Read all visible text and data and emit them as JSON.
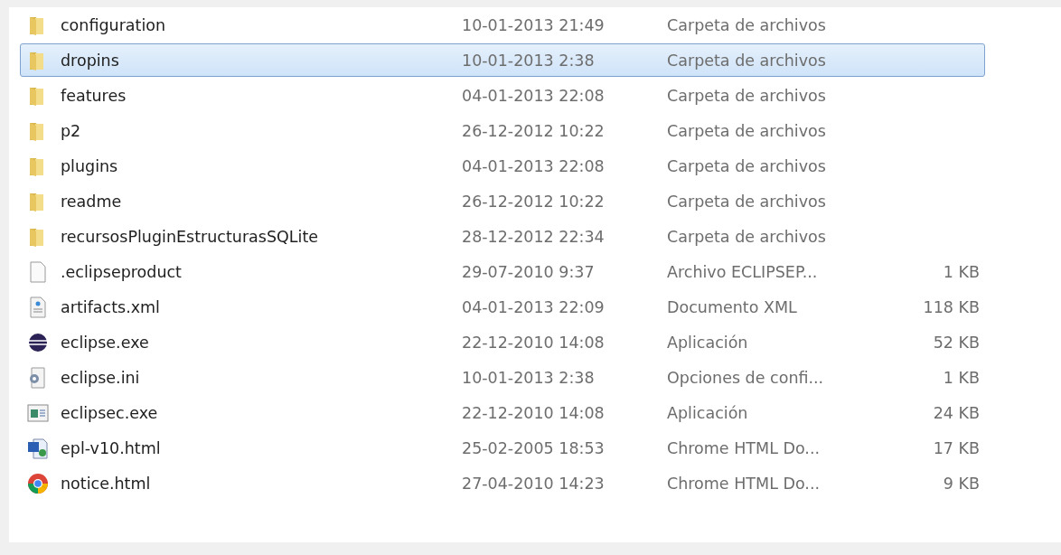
{
  "files": [
    {
      "name": "configuration",
      "date": "10-01-2013 21:49",
      "type": "Carpeta de archivos",
      "kind": "folder",
      "selected": false
    },
    {
      "name": "dropins",
      "date": "10-01-2013 2:38",
      "type": "Carpeta de archivos",
      "kind": "folder",
      "selected": true
    },
    {
      "name": "features",
      "date": "04-01-2013 22:08",
      "type": "Carpeta de archivos",
      "kind": "folder",
      "selected": false
    },
    {
      "name": "p2",
      "date": "26-12-2012 10:22",
      "type": "Carpeta de archivos",
      "kind": "folder",
      "selected": false
    },
    {
      "name": "plugins",
      "date": "04-01-2013 22:08",
      "type": "Carpeta de archivos",
      "kind": "folder",
      "selected": false
    },
    {
      "name": "readme",
      "date": "26-12-2012 10:22",
      "type": "Carpeta de archivos",
      "kind": "folder",
      "selected": false
    },
    {
      "name": "recursosPluginEstructurasSQLite",
      "date": "28-12-2012 22:34",
      "type": "Carpeta de archivos",
      "kind": "folder",
      "selected": false
    },
    {
      "name": ".eclipseproduct",
      "date": "29-07-2010 9:37",
      "type": "Archivo ECLIPSEP...",
      "size": "1 KB",
      "kind": "blank",
      "selected": false
    },
    {
      "name": "artifacts.xml",
      "date": "04-01-2013 22:09",
      "type": "Documento XML",
      "size": "118 KB",
      "kind": "xml",
      "selected": false
    },
    {
      "name": "eclipse.exe",
      "date": "22-12-2010 14:08",
      "type": "Aplicación",
      "size": "52 KB",
      "kind": "eclipse",
      "selected": false
    },
    {
      "name": "eclipse.ini",
      "date": "10-01-2013 2:38",
      "type": "Opciones de confi...",
      "size": "1 KB",
      "kind": "settings",
      "selected": false
    },
    {
      "name": "eclipsec.exe",
      "date": "22-12-2010 14:08",
      "type": "Aplicación",
      "size": "24 KB",
      "kind": "window",
      "selected": false
    },
    {
      "name": "epl-v10.html",
      "date": "25-02-2005 18:53",
      "type": "Chrome HTML Do...",
      "size": "17 KB",
      "kind": "word",
      "selected": false
    },
    {
      "name": "notice.html",
      "date": "27-04-2010 14:23",
      "type": "Chrome HTML Do...",
      "size": "9 KB",
      "kind": "chrome",
      "selected": false
    }
  ]
}
